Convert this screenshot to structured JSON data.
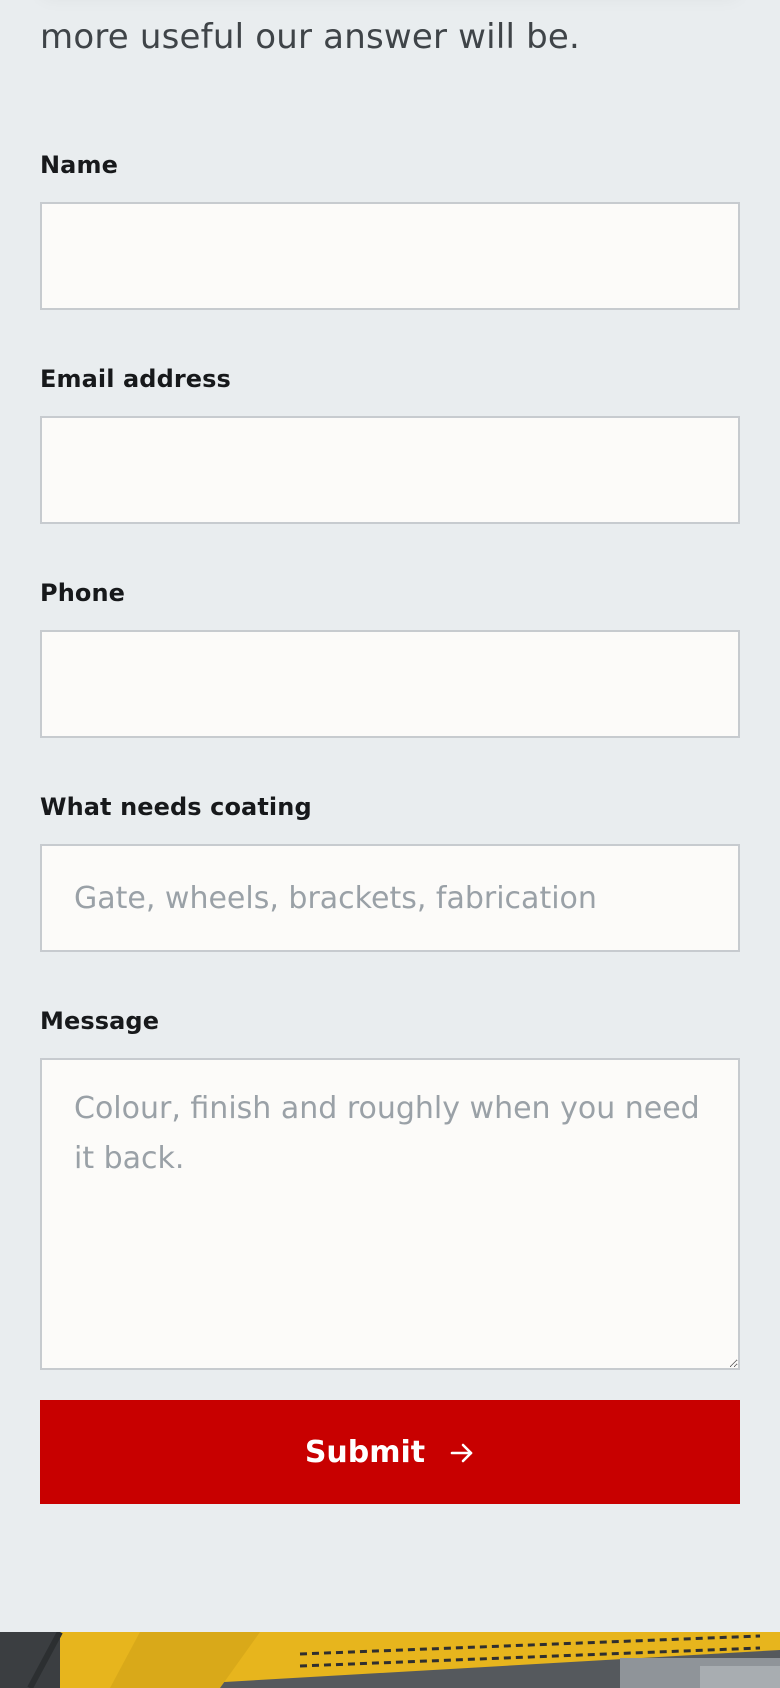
{
  "intro": {
    "text": "more useful our answer will be."
  },
  "form": {
    "name_label": "Name",
    "name_value": "",
    "email_label": "Email address",
    "email_value": "",
    "phone_label": "Phone",
    "phone_value": "",
    "coating_label": "What needs coating",
    "coating_placeholder": "Gate, wheels, brackets, fabrication",
    "coating_value": "",
    "message_label": "Message",
    "message_placeholder": "Colour, finish and roughly when you need it back.",
    "message_value": "",
    "submit_label": "Submit"
  },
  "icons": {
    "submit_icon": "arrow-right-icon"
  },
  "colors": {
    "page_background": "#e9edef",
    "input_background": "#fcfbf9",
    "accent": "#c80000"
  }
}
